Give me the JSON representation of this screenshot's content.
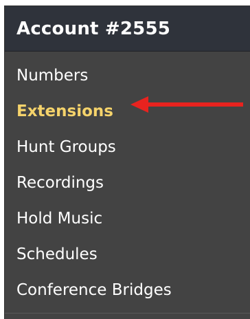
{
  "header": {
    "title": "Account #2555"
  },
  "menu": {
    "items": [
      {
        "label": "Numbers",
        "active": false
      },
      {
        "label": "Extensions",
        "active": true
      },
      {
        "label": "Hunt Groups",
        "active": false
      },
      {
        "label": "Recordings",
        "active": false
      },
      {
        "label": "Hold Music",
        "active": false
      },
      {
        "label": "Schedules",
        "active": false
      },
      {
        "label": "Conference Bridges",
        "active": false
      }
    ]
  },
  "colors": {
    "panel_bg": "#434343",
    "header_bg": "#2f333b",
    "active_text": "#f5d36b",
    "arrow": "#e8231f"
  },
  "annotation": {
    "icon": "arrow-left-icon"
  }
}
